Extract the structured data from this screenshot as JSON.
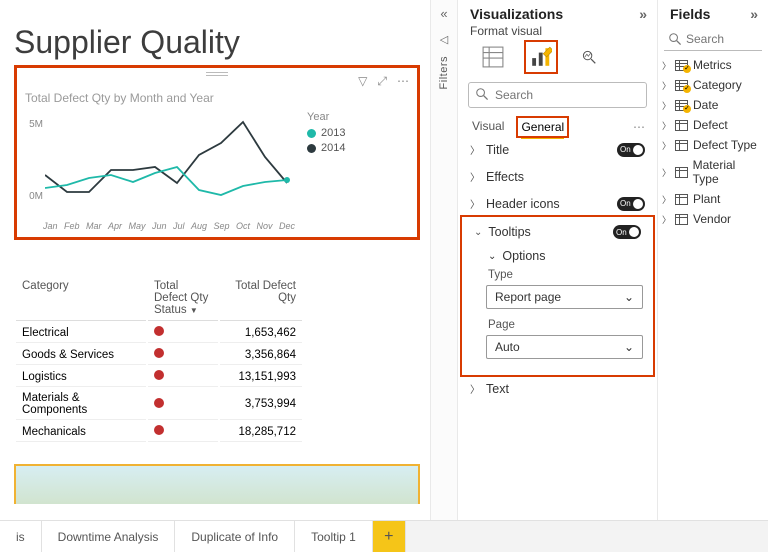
{
  "page_title": "Supplier Quality",
  "chart": {
    "title": "Total Defect Qty by Month and Year",
    "legend_title": "Year",
    "series": [
      {
        "name": "2013",
        "color": "#1fb9a9"
      },
      {
        "name": "2014",
        "color": "#2d3a3f"
      }
    ],
    "ylabels": [
      "5M",
      "0M"
    ]
  },
  "chart_data": {
    "type": "line",
    "title": "Total Defect Qty by Month and Year",
    "xlabel": "",
    "ylabel": "",
    "categories": [
      "Jan",
      "Feb",
      "Mar",
      "Apr",
      "May",
      "Jun",
      "Jul",
      "Aug",
      "Sep",
      "Oct",
      "Nov",
      "Dec"
    ],
    "ylim": [
      0,
      6000000
    ],
    "series": [
      {
        "name": "2013",
        "color": "#1fb9a9",
        "values": [
          1500000,
          1700000,
          2100000,
          2300000,
          1900000,
          2400000,
          2800000,
          1400000,
          1100000,
          1600000,
          1900000,
          2000000
        ]
      },
      {
        "name": "2014",
        "color": "#2d3a3f",
        "values": [
          2300000,
          1300000,
          1300000,
          2600000,
          2600000,
          2800000,
          1800000,
          3500000,
          4200000,
          5500000,
          3400000,
          1900000
        ]
      }
    ]
  },
  "table": {
    "headers": [
      "Category",
      "Total Defect Qty Status",
      "Total Defect Qty"
    ],
    "rows": [
      {
        "cat": "Electrical",
        "qty": "1,653,462"
      },
      {
        "cat": "Goods & Services",
        "qty": "3,356,864"
      },
      {
        "cat": "Logistics",
        "qty": "13,151,993"
      },
      {
        "cat": "Materials & Components",
        "qty": "3,753,994"
      },
      {
        "cat": "Mechanicals",
        "qty": "18,285,712"
      }
    ]
  },
  "page_tabs": [
    "is",
    "Downtime Analysis",
    "Duplicate of Info",
    "Tooltip 1"
  ],
  "filters_label": "Filters",
  "viz": {
    "title": "Visualizations",
    "subtitle": "Format visual",
    "search_ph": "Search",
    "tabs": {
      "visual": "Visual",
      "general": "General"
    },
    "props": {
      "title": "Title",
      "effects": "Effects",
      "header": "Header icons",
      "tooltips": "Tooltips",
      "text": "Text",
      "options": "Options"
    },
    "toggle_on": "On",
    "type_label": "Type",
    "type_value": "Report page",
    "page_label": "Page",
    "page_value": "Auto"
  },
  "fields": {
    "title": "Fields",
    "search_ph": "Search",
    "items": [
      {
        "label": "Metrics",
        "checked": true,
        "kind": "metrics"
      },
      {
        "label": "Category",
        "checked": true,
        "kind": "table"
      },
      {
        "label": "Date",
        "checked": true,
        "kind": "table"
      },
      {
        "label": "Defect",
        "checked": false,
        "kind": "table"
      },
      {
        "label": "Defect Type",
        "checked": false,
        "kind": "table"
      },
      {
        "label": "Material Type",
        "checked": false,
        "kind": "table"
      },
      {
        "label": "Plant",
        "checked": false,
        "kind": "table"
      },
      {
        "label": "Vendor",
        "checked": false,
        "kind": "table"
      }
    ]
  }
}
